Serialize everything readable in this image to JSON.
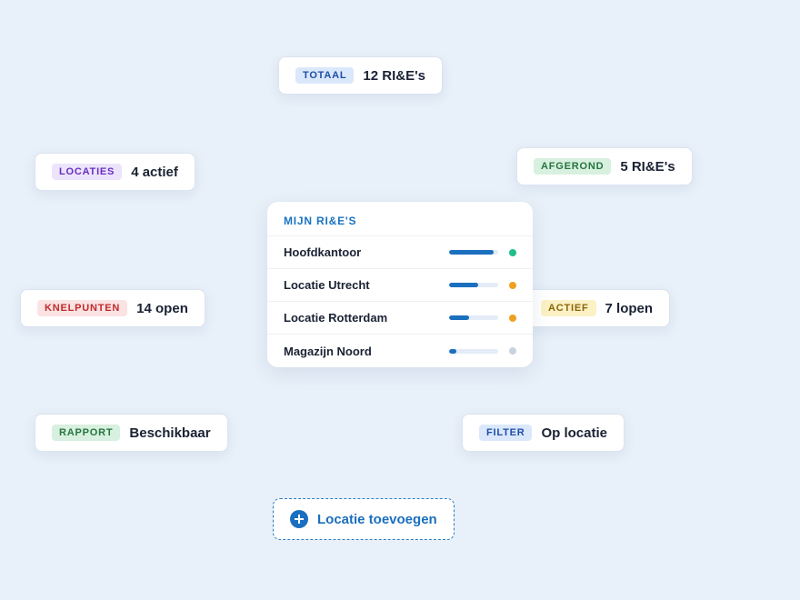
{
  "cards": {
    "totaal": {
      "tag": "TOTAAL",
      "value": "12 RI&E's"
    },
    "locaties": {
      "tag": "LOCATIES",
      "value": "4 actief"
    },
    "afgerond": {
      "tag": "AFGEROND",
      "value": "5 RI&E's"
    },
    "knelpunten": {
      "tag": "KNELPUNTEN",
      "value": "14 open"
    },
    "actief": {
      "tag": "ACTIEF",
      "value": "7 lopen"
    },
    "rapport": {
      "tag": "RAPPORT",
      "value": "Beschikbaar"
    },
    "filter": {
      "tag": "FILTER",
      "value": "Op locatie"
    }
  },
  "panel": {
    "title": "MIJN RI&E'S",
    "rows": [
      {
        "name": "Hoofdkantoor",
        "progress": 0.9,
        "status_color": "#1dbf8a"
      },
      {
        "name": "Locatie Utrecht",
        "progress": 0.6,
        "status_color": "#f0a020"
      },
      {
        "name": "Locatie Rotterdam",
        "progress": 0.4,
        "status_color": "#f0a020"
      },
      {
        "name": "Magazijn Noord",
        "progress": 0.15,
        "status_color": "#c9d3df"
      }
    ]
  },
  "add_button": {
    "label": "Locatie toevoegen",
    "icon": "plus-circle-icon"
  },
  "colors": {
    "accent": "#1a6fbf",
    "background": "#e8f0f9"
  }
}
